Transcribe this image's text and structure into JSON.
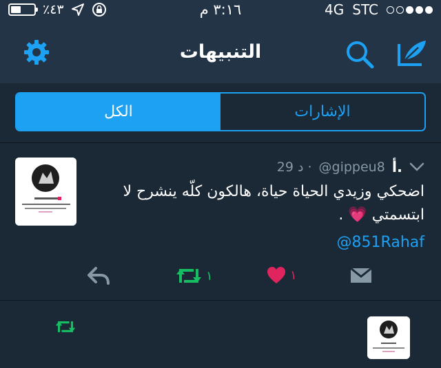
{
  "status_bar": {
    "battery_percent": "٪٤٣",
    "time": "٣:١٦ م",
    "network": "4G",
    "carrier": "STC",
    "signal_bars": 3
  },
  "header": {
    "title": "التنبيهات"
  },
  "segments": [
    {
      "label": "الكل",
      "active": true
    },
    {
      "label": "الإشارات",
      "active": false
    }
  ],
  "tweet": {
    "author": "أ.",
    "handle": "@gippeu8",
    "time": "29 د ·",
    "text": "اضحكي وزيدي الحياة حياة، هالكون كلّه ينشرح لا ابتسمتي 💗 .",
    "mention": "@851Rahaf",
    "retweet_count": "١",
    "like_count": "١"
  },
  "colors": {
    "accent": "#1da1f2",
    "background": "#141d26",
    "header": "#243447",
    "panel": "#1b2836",
    "retweet": "#17bf63",
    "like": "#e0245e",
    "muted": "#8899a6"
  }
}
